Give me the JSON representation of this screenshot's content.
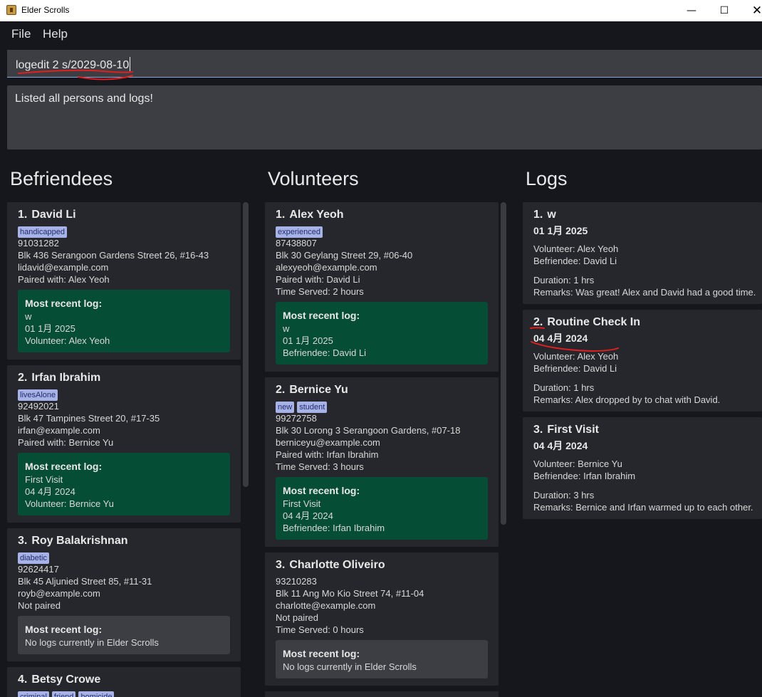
{
  "window": {
    "title": "Elder Scrolls",
    "minimize": "—",
    "maximize": "☐",
    "close": "✕"
  },
  "menu": {
    "file": "File",
    "help": "Help"
  },
  "command": {
    "value": "logedit 2 s/2029-08-10"
  },
  "result": {
    "text": "Listed all persons and logs!"
  },
  "columns": {
    "befriendees": "Befriendees",
    "volunteers": "Volunteers",
    "logs": "Logs"
  },
  "recent_log_title": "Most recent log:",
  "befriendees": [
    {
      "index": "1.",
      "name": "David Li",
      "tags": [
        "handicapped"
      ],
      "phone": "91031282",
      "address": "Blk 436 Serangoon Gardens Street 26, #16-43",
      "email": "lidavid@example.com",
      "paired": "Paired with: Alex Yeoh",
      "recent": {
        "has_log": true,
        "lines": [
          "w",
          "01 1月 2025",
          "Volunteer: Alex Yeoh"
        ]
      }
    },
    {
      "index": "2.",
      "name": "Irfan Ibrahim",
      "tags": [
        "livesAlone"
      ],
      "phone": "92492021",
      "address": "Blk 47 Tampines Street 20, #17-35",
      "email": "irfan@example.com",
      "paired": "Paired with: Bernice Yu",
      "recent": {
        "has_log": true,
        "lines": [
          "First Visit",
          "04 4月 2024",
          "Volunteer: Bernice Yu"
        ]
      }
    },
    {
      "index": "3.",
      "name": "Roy Balakrishnan",
      "tags": [
        "diabetic"
      ],
      "phone": "92624417",
      "address": "Blk 45 Aljunied Street 85, #11-31",
      "email": "royb@example.com",
      "paired": "Not paired",
      "recent": {
        "has_log": false,
        "lines": [
          "No logs currently in Elder Scrolls"
        ]
      }
    },
    {
      "index": "4.",
      "name": "Betsy Crowe",
      "tags": [
        "criminal",
        "friend",
        "homicide"
      ]
    }
  ],
  "volunteers": [
    {
      "index": "1.",
      "name": "Alex Yeoh",
      "tags": [
        "experienced"
      ],
      "phone": "87438807",
      "address": "Blk 30 Geylang Street 29, #06-40",
      "email": "alexyeoh@example.com",
      "paired": "Paired with: David Li",
      "served": "Time Served: 2 hours",
      "recent": {
        "has_log": true,
        "lines": [
          "w",
          "01 1月 2025",
          "Befriendee: David Li"
        ]
      }
    },
    {
      "index": "2.",
      "name": "Bernice Yu",
      "tags": [
        "new",
        "student"
      ],
      "phone": "99272758",
      "address": "Blk 30 Lorong 3 Serangoon Gardens, #07-18",
      "email": "berniceyu@example.com",
      "paired": "Paired with: Irfan Ibrahim",
      "served": "Time Served: 3 hours",
      "recent": {
        "has_log": true,
        "lines": [
          "First Visit",
          "04 4月 2024",
          "Befriendee: Irfan Ibrahim"
        ]
      }
    },
    {
      "index": "3.",
      "name": "Charlotte Oliveiro",
      "tags": [],
      "phone": "93210283",
      "address": "Blk 11 Ang Mo Kio Street 74, #11-04",
      "email": "charlotte@example.com",
      "paired": "Not paired",
      "served": "Time Served: 0 hours",
      "recent": {
        "has_log": false,
        "lines": [
          "No logs currently in Elder Scrolls"
        ]
      }
    }
  ],
  "logs": [
    {
      "index": "1.",
      "name": "w",
      "date": "01 1月 2025",
      "volunteer": "Volunteer: Alex Yeoh",
      "befriendee": "Befriendee: David Li",
      "duration": "Duration: 1 hrs",
      "remarks": "Remarks: Was great! Alex and David had a good time."
    },
    {
      "index": "2.",
      "name": "Routine Check In",
      "date": "04 4月 2024",
      "volunteer": "Volunteer: Alex Yeoh",
      "befriendee": "Befriendee: David Li",
      "duration": "Duration: 1 hrs",
      "remarks": "Remarks: Alex dropped by to chat with David."
    },
    {
      "index": "3.",
      "name": "First Visit",
      "date": "04 4月 2024",
      "volunteer": "Volunteer: Bernice Yu",
      "befriendee": "Befriendee: Irfan Ibrahim",
      "duration": "Duration: 3 hrs",
      "remarks": "Remarks: Bernice and Irfan warmed up to each other."
    }
  ],
  "colors": {
    "background": "#16171c",
    "card": "#26272c",
    "input": "#3c3e44",
    "recent_green": "#064d35",
    "tag_bg": "#a7b2e6",
    "annotation": "#e02020"
  }
}
